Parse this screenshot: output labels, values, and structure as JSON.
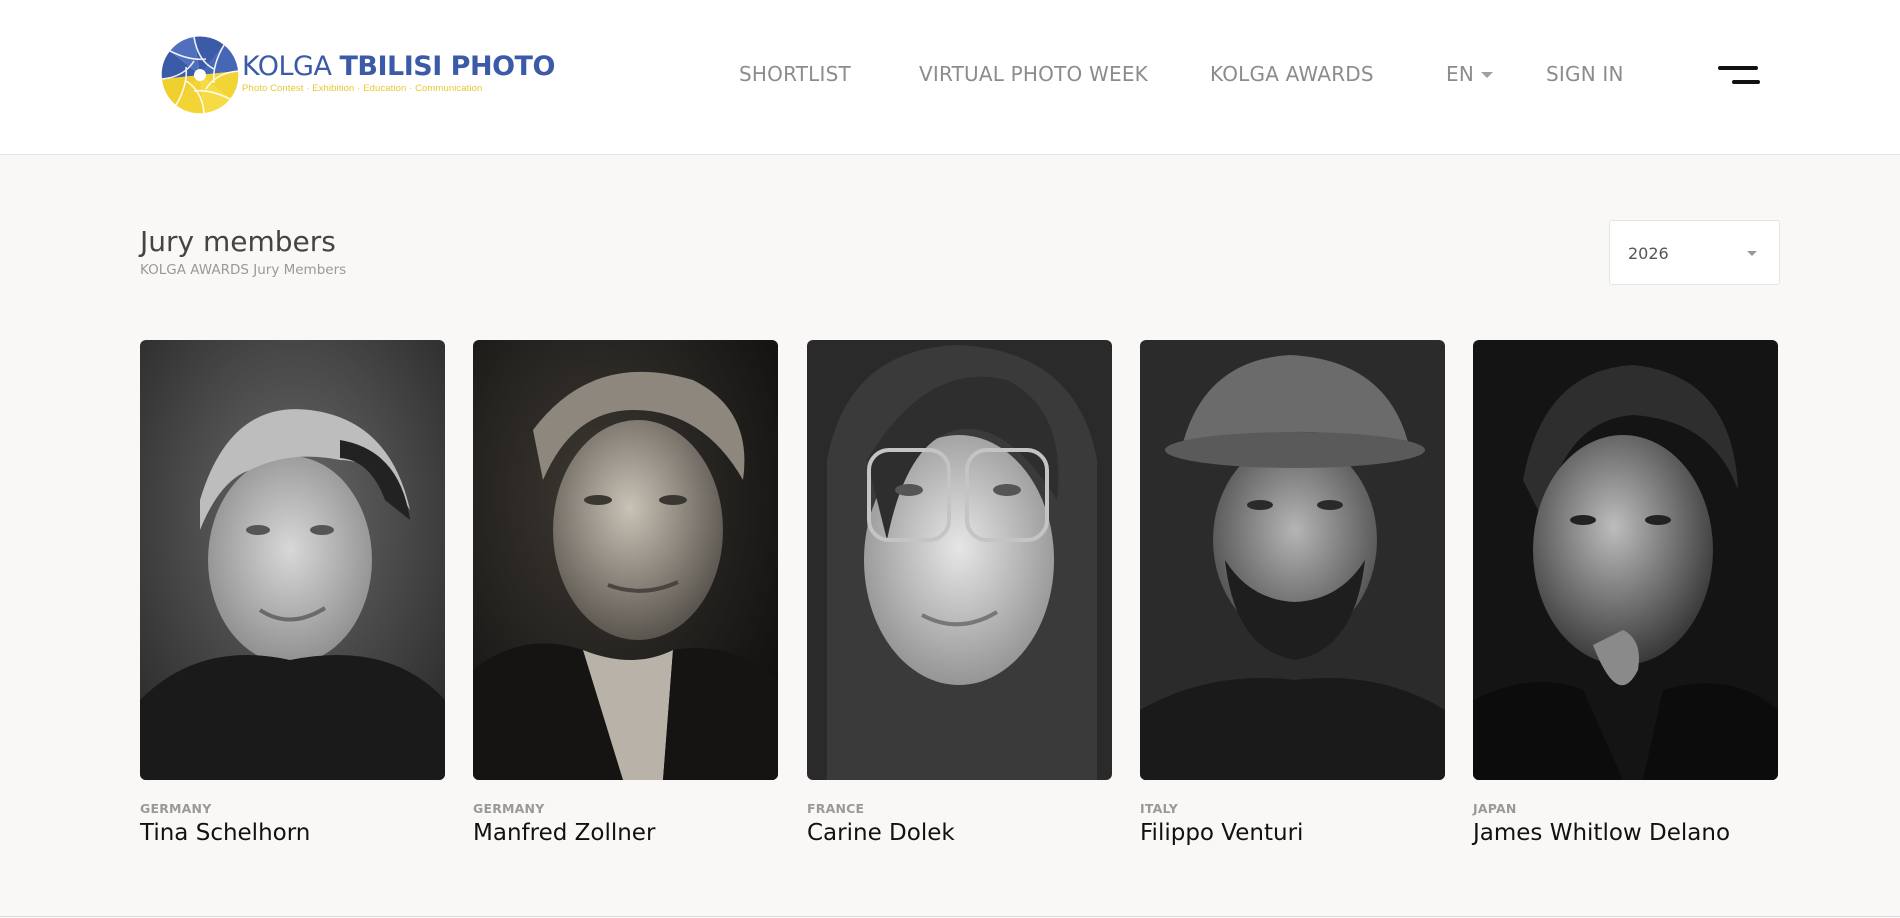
{
  "header": {
    "logo": {
      "title_light": "KOLGA ",
      "title_bold": "TBILISI PHOTO",
      "tagline": "Photo Contest · Exhibition · Education · Communication"
    },
    "nav": {
      "shortlist": "SHORTLIST",
      "virtual_photo_week": "VIRTUAL PHOTO WEEK",
      "kolga_awards": "KOLGA AWARDS",
      "language": "EN",
      "sign_in": "SIGN IN"
    },
    "menu_icon": "hamburger-menu-icon"
  },
  "section": {
    "title": "Jury members",
    "subtitle": "KOLGA AWARDS Jury Members",
    "year_select": {
      "selected": "2026"
    }
  },
  "jury": [
    {
      "country": "GERMANY",
      "name": "Tina Schelhorn"
    },
    {
      "country": "GERMANY",
      "name": "Manfred Zollner"
    },
    {
      "country": "FRANCE",
      "name": "Carine Dolek"
    },
    {
      "country": "ITALY",
      "name": "Filippo Venturi"
    },
    {
      "country": "JAPAN",
      "name": "James Whitlow Delano"
    }
  ],
  "colors": {
    "brand_blue": "#3b5aa8",
    "brand_yellow": "#f2d535",
    "nav_text": "#8c8c8c",
    "page_bg": "#f9f8f6"
  }
}
